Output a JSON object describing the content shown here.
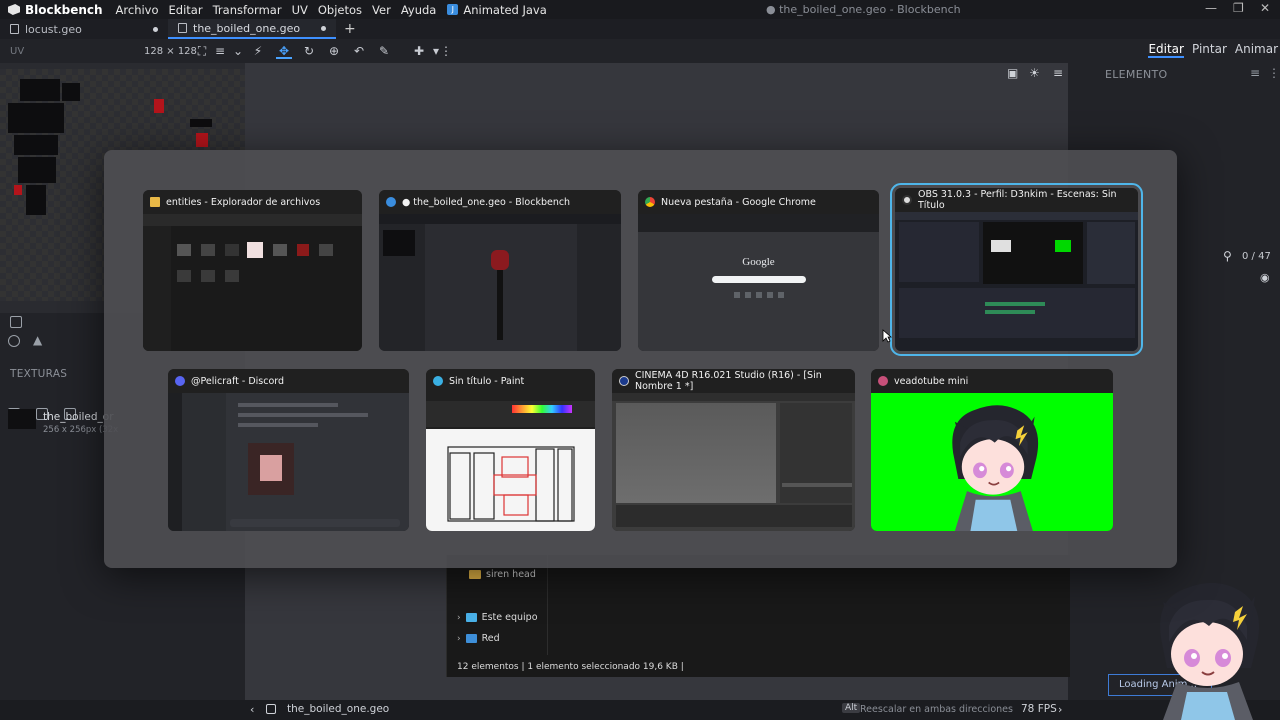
{
  "app": {
    "name": "Blockbench",
    "window_title": "● the_boiled_one.geo - Blockbench"
  },
  "menu": [
    "Archivo",
    "Editar",
    "Transformar",
    "UV",
    "Objetos",
    "Ver",
    "Ayuda"
  ],
  "plugin_menu": "Animated Java",
  "file_tabs": [
    {
      "label": "locust.geo",
      "unsaved": true,
      "active": false
    },
    {
      "label": "the_boiled_one.geo",
      "unsaved": true,
      "active": true
    }
  ],
  "toolbar": {
    "uv_label": "UV",
    "resolution": "128 × 128"
  },
  "modes": [
    "Editar",
    "Pintar",
    "Animar"
  ],
  "right_panel": {
    "element_label": "ELEMENTO",
    "element_count": "0 / 47",
    "loading_text": "Loading Anim..."
  },
  "textures": {
    "section_label": "TEXTURAS",
    "name": "the_boiled_or",
    "size": "256 x 256px (32x"
  },
  "explorer": {
    "items": [
      "siren head",
      "Este equipo",
      "Red"
    ],
    "status": "12 elementos  |  1 elemento seleccionado  19,6 KB  |"
  },
  "statusbar": {
    "file": "the_boiled_one.geo",
    "alt_key": "Alt",
    "hint": "Reescalar en ambas direcciones",
    "fps": "78 FPS"
  },
  "switcher": {
    "windows": [
      {
        "title": "entities - Explorador de archivos",
        "app": "explorer",
        "selected": false
      },
      {
        "title": "● the_boiled_one.geo - Blockbench",
        "app": "blockbench",
        "selected": false
      },
      {
        "title": "Nueva pestaña - Google Chrome",
        "app": "chrome",
        "selected": false
      },
      {
        "title": "OBS 31.0.3 - Perfil: D3nkim - Escenas: Sin Título",
        "app": "obs",
        "selected": true
      },
      {
        "title": "@Pelicraft - Discord",
        "app": "discord",
        "selected": false
      },
      {
        "title": "Sin título - Paint",
        "app": "paint",
        "selected": false
      },
      {
        "title": "CINEMA 4D R16.021 Studio (R16) - [Sin Nombre 1 *]",
        "app": "cinema4d",
        "selected": false
      },
      {
        "title": "veadotube mini",
        "app": "veadotube",
        "selected": false
      }
    ],
    "chrome_logo_text": "Google"
  },
  "colors": {
    "accent": "#3e90ff",
    "selection": "#4fb6ea",
    "green_screen": "#00ff00",
    "red_pixel": "#b3141b"
  }
}
